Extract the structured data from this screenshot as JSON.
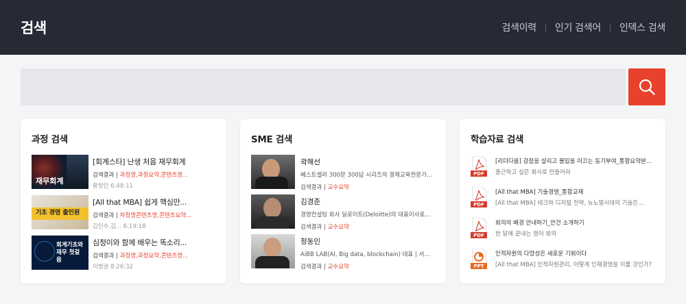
{
  "header": {
    "title": "검색",
    "nav": [
      "검색이력",
      "인기 검색어",
      "인덱스 검색"
    ]
  },
  "search": {
    "value": "",
    "placeholder": ""
  },
  "colors": {
    "accent": "#e8412c",
    "header_bg": "#262a35"
  },
  "courses": {
    "title": "과정 검색",
    "items": [
      {
        "title": "[회계스타] 난생 처음 재무회계",
        "meta_prefix": "검색결과 | ",
        "meta_hl": "과정명,과정요약,콘텐츠명...",
        "date": "황창인 6:48:11",
        "thumb_text": "재무회계"
      },
      {
        "title": "[All that MBA] 쉽게 핵심만...",
        "meta_prefix": "검색결과 | ",
        "meta_hl": "차정명콘텐츠명,콘텐츠요약...",
        "date": "김인수,김... 6:19:18",
        "thumb_text": "기초 경영 출인원"
      },
      {
        "title": "심청이와 함께 배우는 똑소리...",
        "meta_prefix": "검색결과 | ",
        "meta_hl": "과정명,과정요약,콘텐츠명...",
        "date": "이범권 8:26:32",
        "thumb_text": "회계기초와 재무 첫걸음"
      }
    ]
  },
  "sme": {
    "title": "SME 검색",
    "items": [
      {
        "name": "곽해선",
        "desc": "베스트셀러 300문 300답 시리즈의 경제교육전문가...",
        "meta_prefix": "검색결과 | ",
        "meta_hl": "교수요약"
      },
      {
        "name": "김경준",
        "desc": "경영컨설팅 회사 딜로이트(Deloitte)의 대표이사로...",
        "meta_prefix": "검색결과 | ",
        "meta_hl": "교수요약"
      },
      {
        "name": "정동인",
        "desc": "AiBB LAB(AI, Big data, blockchain) 대표 | 서울 ...",
        "meta_prefix": "검색결과 | ",
        "meta_hl": "교수요약"
      }
    ]
  },
  "materials": {
    "title": "학습자료 검색",
    "items": [
      {
        "type": "PDF",
        "title": "[리더다움] 강점을 살리고 몰입을 이끄는 동기부여_통합요약본...",
        "sub": "출근하고 싶은 회사로 만들어라"
      },
      {
        "type": "PDF",
        "title": "[All that MBA] 기술경영_통합교재",
        "sub": "[All that MBA] 테크와 디지털 전략, 뉴노멀시대의 기술은..."
      },
      {
        "type": "PDF",
        "title": "회의의 배경 안내하기_안건 소개하기",
        "sub": "한 달에 끝내는 영어 회의"
      },
      {
        "type": "PPT",
        "title": "인적자원의 다양성은 새로운 기회이다",
        "sub": "[All that MBA] 인적자원관리, 어떻게 인재경영을 이룰 것인가?"
      }
    ]
  }
}
